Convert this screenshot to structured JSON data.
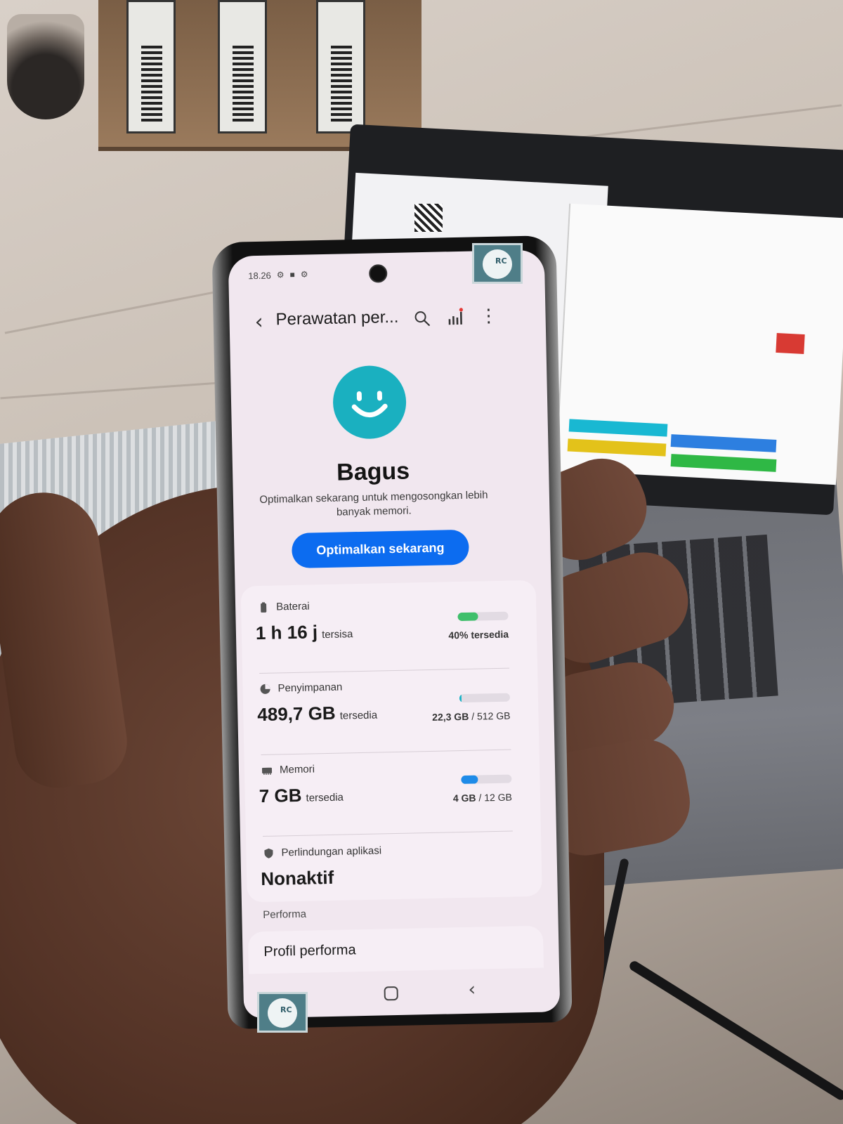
{
  "status_bar": {
    "time": "18.26",
    "icons": [
      "settings-icon",
      "bag-icon",
      "gear-icon"
    ]
  },
  "app_bar": {
    "title": "Perawatan per...",
    "back_icon": "back-chevron-icon",
    "search_icon": "search-icon",
    "stats_icon": "stats-icon",
    "more_icon": "more-vert-icon"
  },
  "summary": {
    "face_icon": "smiley-face-icon",
    "status": "Bagus",
    "description": "Optimalkan sekarang untuk mengosongkan lebih banyak memori.",
    "button_label": "Optimalkan sekarang",
    "accent_color": "#1ab0c0",
    "button_color": "#0c6cf0"
  },
  "items": {
    "battery": {
      "label": "Baterai",
      "value": "1 h 16 j",
      "suffix": "tersisa",
      "right_text": "40% tersedia",
      "meter_level": 0.4,
      "meter_color": "#3fbf6b"
    },
    "storage": {
      "label": "Penyimpanan",
      "value": "489,7 GB",
      "suffix": "tersedia",
      "used": "22,3 GB",
      "total": "/ 512 GB",
      "meter_level": 0.044,
      "meter_color": "#19b3c6"
    },
    "memory": {
      "label": "Memori",
      "value": "7 GB",
      "suffix": "tersedia",
      "used": "4 GB",
      "total": "/ 12 GB",
      "meter_level": 0.33,
      "meter_color": "#1e8be8"
    },
    "app_protection": {
      "label": "Perlindungan aplikasi",
      "value": "Nonaktif"
    }
  },
  "performance": {
    "section_label": "Performa",
    "profile_label": "Profil performa"
  },
  "nav": {
    "home_icon": "home-button-icon",
    "back_icon": "back-button-icon"
  }
}
